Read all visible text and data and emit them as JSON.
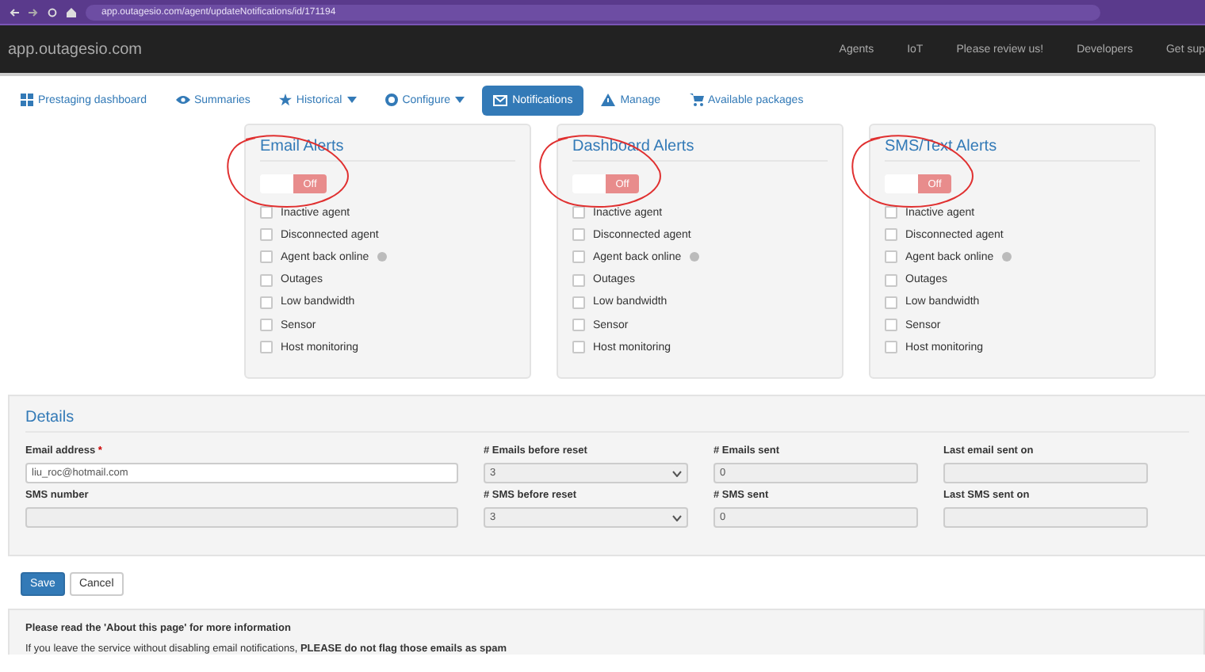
{
  "browser": {
    "url": "app.outagesio.com/agent/updateNotifications/id/171194"
  },
  "navbar": {
    "brand": "app.outagesio.com",
    "links": [
      "Agents",
      "IoT",
      "Please review us!",
      "Developers",
      "Get sup"
    ]
  },
  "tabs": [
    {
      "label": "Prestaging dashboard",
      "dropdown": false,
      "selected": false
    },
    {
      "label": "Summaries",
      "dropdown": false,
      "selected": false
    },
    {
      "label": "Historical",
      "dropdown": true,
      "selected": false
    },
    {
      "label": "Configure",
      "dropdown": true,
      "selected": false
    },
    {
      "label": "Notifications",
      "dropdown": false,
      "selected": true
    },
    {
      "label": "Manage",
      "dropdown": false,
      "selected": false
    },
    {
      "label": "Available packages",
      "dropdown": false,
      "selected": false
    }
  ],
  "alert_panels": [
    {
      "title": "Email Alerts",
      "toggle": {
        "on": false,
        "label": "Off"
      },
      "annotated": true,
      "options": [
        {
          "label": "Inactive agent",
          "checked": false,
          "help": false
        },
        {
          "label": "Disconnected agent",
          "checked": false,
          "help": false
        },
        {
          "label": "Agent back online",
          "checked": false,
          "help": true
        },
        {
          "label": "Outages",
          "checked": false,
          "help": false
        },
        {
          "label": "Low bandwidth",
          "checked": false,
          "help": false
        },
        {
          "label": "Sensor",
          "checked": false,
          "help": false
        },
        {
          "label": "Host monitoring",
          "checked": false,
          "help": false
        }
      ]
    },
    {
      "title": "Dashboard Alerts",
      "toggle": {
        "on": false,
        "label": "Off"
      },
      "annotated": true,
      "options": [
        {
          "label": "Inactive agent",
          "checked": false,
          "help": false
        },
        {
          "label": "Disconnected agent",
          "checked": false,
          "help": false
        },
        {
          "label": "Agent back online",
          "checked": false,
          "help": true
        },
        {
          "label": "Outages",
          "checked": false,
          "help": false
        },
        {
          "label": "Low bandwidth",
          "checked": false,
          "help": false
        },
        {
          "label": "Sensor",
          "checked": false,
          "help": false
        },
        {
          "label": "Host monitoring",
          "checked": false,
          "help": false
        }
      ]
    },
    {
      "title": "SMS/Text Alerts",
      "toggle": {
        "on": false,
        "label": "Off"
      },
      "annotated": true,
      "options": [
        {
          "label": "Inactive agent",
          "checked": false,
          "help": false
        },
        {
          "label": "Disconnected agent",
          "checked": false,
          "help": false
        },
        {
          "label": "Agent back online",
          "checked": false,
          "help": true
        },
        {
          "label": "Outages",
          "checked": false,
          "help": false
        },
        {
          "label": "Low bandwidth",
          "checked": false,
          "help": false
        },
        {
          "label": "Sensor",
          "checked": false,
          "help": false
        },
        {
          "label": "Host monitoring",
          "checked": false,
          "help": false
        }
      ]
    }
  ],
  "details": {
    "title": "Details",
    "fields": [
      {
        "label": "Email address",
        "required_mark": "*",
        "kind": "text",
        "value": "liu_roc@hotmail.com",
        "disabled": false
      },
      {
        "label": "# Emails before reset",
        "kind": "select",
        "value": "3",
        "disabled": true
      },
      {
        "label": "# Emails sent",
        "kind": "text",
        "value": "0",
        "disabled": true
      },
      {
        "label": "Last email sent on",
        "kind": "text",
        "disabled": true
      },
      {
        "label": "SMS number",
        "kind": "text",
        "disabled": true
      },
      {
        "label": "# SMS before reset",
        "kind": "select",
        "value": "3",
        "disabled": true
      },
      {
        "label": "# SMS sent",
        "kind": "text",
        "value": "0",
        "disabled": true
      },
      {
        "label": "Last SMS sent on",
        "kind": "text",
        "disabled": true
      }
    ]
  },
  "buttons": [
    {
      "label": "Save",
      "kind": "primary"
    },
    {
      "label": "Cancel",
      "kind": "default"
    }
  ],
  "info": {
    "heading": "Please read the 'About this page' for more information",
    "text": "If you leave the service without disabling email notifications, **PLEASE do not flag those emails as spam**"
  }
}
